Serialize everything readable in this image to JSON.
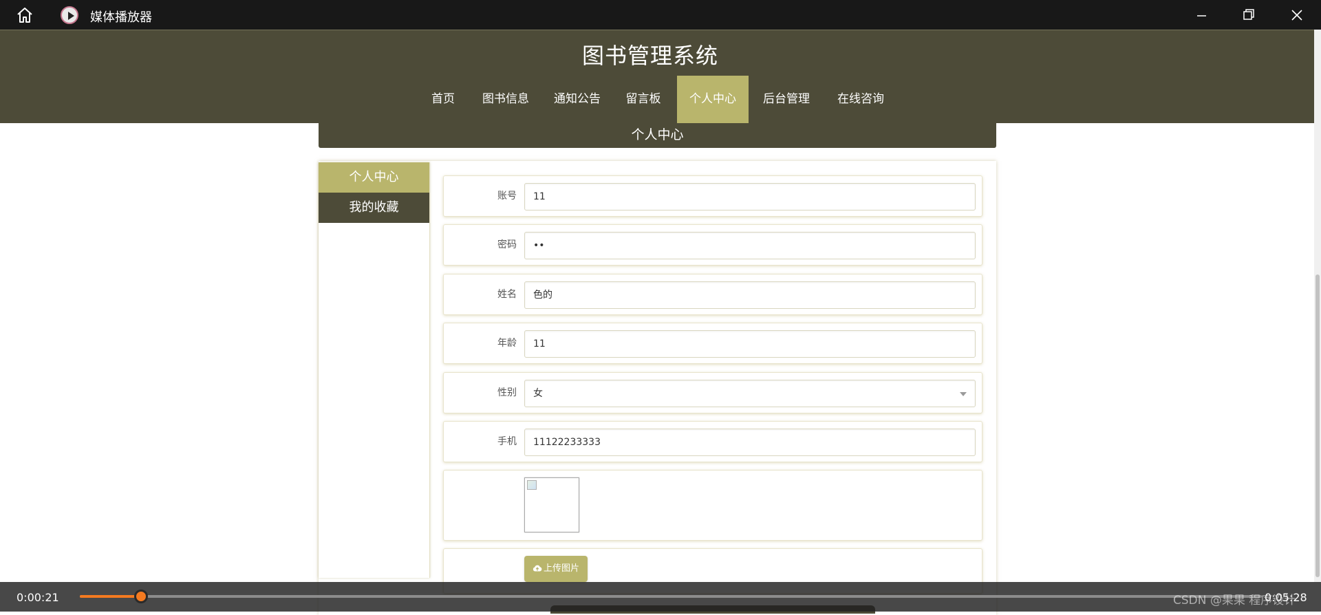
{
  "player": {
    "title": "媒体播放器",
    "current_time": "0:00:21",
    "total_time": "0:05:28",
    "progress": 0.052,
    "watermark": "CSDN @果果 程序设计",
    "accent_color": "#f47a20"
  },
  "site": {
    "title": "图书管理系统",
    "theme_dark": "#4d4b38",
    "theme_accent": "#b9b56c"
  },
  "nav": {
    "items": [
      {
        "label": "首页"
      },
      {
        "label": "图书信息"
      },
      {
        "label": "通知公告"
      },
      {
        "label": "留言板"
      },
      {
        "label": "个人中心",
        "active": true
      },
      {
        "label": "后台管理"
      },
      {
        "label": "在线咨询"
      }
    ]
  },
  "section": {
    "title": "个人中心"
  },
  "side_menu": {
    "items": [
      {
        "label": "个人中心",
        "active": true
      },
      {
        "label": "我的收藏"
      }
    ]
  },
  "form": {
    "account": {
      "label": "账号",
      "value": "11"
    },
    "password": {
      "label": "密码",
      "value": "••"
    },
    "name": {
      "label": "姓名",
      "value": "色的"
    },
    "age": {
      "label": "年龄",
      "value": "11"
    },
    "gender": {
      "label": "性别",
      "value": "女"
    },
    "phone": {
      "label": "手机",
      "value": "11122233333"
    },
    "upload_button": "上传图片"
  },
  "icons": {
    "home": "home-icon",
    "app": "media-player-icon",
    "minimize": "minimize-icon",
    "maximize": "maximize-icon",
    "close": "close-icon",
    "upload": "cloud-upload-icon",
    "select": "chevron-down-icon",
    "broken_image": "broken-image-icon"
  }
}
